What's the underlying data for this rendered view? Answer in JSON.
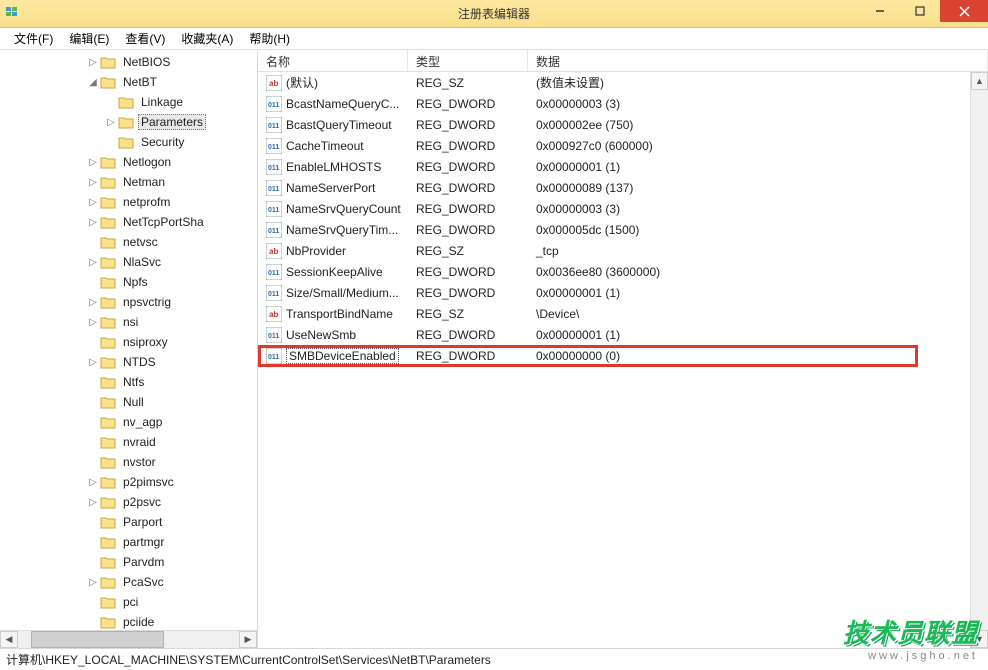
{
  "window": {
    "title": "注册表编辑器"
  },
  "menu": {
    "file": "文件(F)",
    "edit": "编辑(E)",
    "view": "查看(V)",
    "favorites": "收藏夹(A)",
    "help": "帮助(H)"
  },
  "tree": {
    "items": [
      {
        "depth": 2,
        "tw": "▷",
        "label": "NetBIOS"
      },
      {
        "depth": 2,
        "tw": "◢",
        "label": "NetBT"
      },
      {
        "depth": 3,
        "tw": "",
        "label": "Linkage"
      },
      {
        "depth": 3,
        "tw": "▷",
        "label": "Parameters",
        "selected": true
      },
      {
        "depth": 3,
        "tw": "",
        "label": "Security"
      },
      {
        "depth": 2,
        "tw": "▷",
        "label": "Netlogon"
      },
      {
        "depth": 2,
        "tw": "▷",
        "label": "Netman"
      },
      {
        "depth": 2,
        "tw": "▷",
        "label": "netprofm"
      },
      {
        "depth": 2,
        "tw": "▷",
        "label": "NetTcpPortSha"
      },
      {
        "depth": 2,
        "tw": "",
        "label": "netvsc"
      },
      {
        "depth": 2,
        "tw": "▷",
        "label": "NlaSvc"
      },
      {
        "depth": 2,
        "tw": "",
        "label": "Npfs"
      },
      {
        "depth": 2,
        "tw": "▷",
        "label": "npsvctrig"
      },
      {
        "depth": 2,
        "tw": "▷",
        "label": "nsi"
      },
      {
        "depth": 2,
        "tw": "",
        "label": "nsiproxy"
      },
      {
        "depth": 2,
        "tw": "▷",
        "label": "NTDS"
      },
      {
        "depth": 2,
        "tw": "",
        "label": "Ntfs"
      },
      {
        "depth": 2,
        "tw": "",
        "label": "Null"
      },
      {
        "depth": 2,
        "tw": "",
        "label": "nv_agp"
      },
      {
        "depth": 2,
        "tw": "",
        "label": "nvraid"
      },
      {
        "depth": 2,
        "tw": "",
        "label": "nvstor"
      },
      {
        "depth": 2,
        "tw": "▷",
        "label": "p2pimsvc"
      },
      {
        "depth": 2,
        "tw": "▷",
        "label": "p2psvc"
      },
      {
        "depth": 2,
        "tw": "",
        "label": "Parport"
      },
      {
        "depth": 2,
        "tw": "",
        "label": "partmgr"
      },
      {
        "depth": 2,
        "tw": "",
        "label": "Parvdm"
      },
      {
        "depth": 2,
        "tw": "▷",
        "label": "PcaSvc"
      },
      {
        "depth": 2,
        "tw": "",
        "label": "pci"
      },
      {
        "depth": 2,
        "tw": "",
        "label": "pciide"
      }
    ]
  },
  "columns": {
    "name": "名称",
    "type": "类型",
    "data": "数据"
  },
  "values": [
    {
      "icon": "sz",
      "name": "(默认)",
      "type": "REG_SZ",
      "data": "(数值未设置)"
    },
    {
      "icon": "dw",
      "name": "BcastNameQueryC...",
      "type": "REG_DWORD",
      "data": "0x00000003 (3)"
    },
    {
      "icon": "dw",
      "name": "BcastQueryTimeout",
      "type": "REG_DWORD",
      "data": "0x000002ee (750)"
    },
    {
      "icon": "dw",
      "name": "CacheTimeout",
      "type": "REG_DWORD",
      "data": "0x000927c0 (600000)"
    },
    {
      "icon": "dw",
      "name": "EnableLMHOSTS",
      "type": "REG_DWORD",
      "data": "0x00000001 (1)"
    },
    {
      "icon": "dw",
      "name": "NameServerPort",
      "type": "REG_DWORD",
      "data": "0x00000089 (137)"
    },
    {
      "icon": "dw",
      "name": "NameSrvQueryCount",
      "type": "REG_DWORD",
      "data": "0x00000003 (3)"
    },
    {
      "icon": "dw",
      "name": "NameSrvQueryTim...",
      "type": "REG_DWORD",
      "data": "0x000005dc (1500)"
    },
    {
      "icon": "sz",
      "name": "NbProvider",
      "type": "REG_SZ",
      "data": "_tcp"
    },
    {
      "icon": "dw",
      "name": "SessionKeepAlive",
      "type": "REG_DWORD",
      "data": "0x0036ee80 (3600000)"
    },
    {
      "icon": "dw",
      "name": "Size/Small/Medium...",
      "type": "REG_DWORD",
      "data": "0x00000001 (1)"
    },
    {
      "icon": "sz",
      "name": "TransportBindName",
      "type": "REG_SZ",
      "data": "\\Device\\"
    },
    {
      "icon": "dw",
      "name": "UseNewSmb",
      "type": "REG_DWORD",
      "data": "0x00000001 (1)"
    },
    {
      "icon": "dw",
      "name": "SMBDeviceEnabled",
      "type": "REG_DWORD",
      "data": "0x00000000 (0)",
      "highlight": true
    }
  ],
  "status": {
    "path": "计算机\\HKEY_LOCAL_MACHINE\\SYSTEM\\CurrentControlSet\\Services\\NetBT\\Parameters"
  },
  "watermark": {
    "main": "技术员联盟",
    "sub": "www.jsgho.net"
  }
}
